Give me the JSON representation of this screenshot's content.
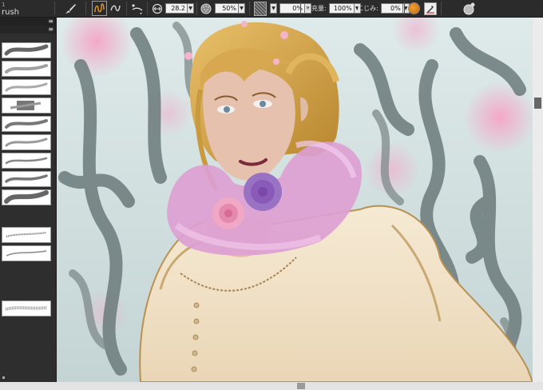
{
  "panel": {
    "title": "rush",
    "number": "1"
  },
  "toolbar": {
    "brush_size": "28.2",
    "density": "50%",
    "texture_strength": "0%",
    "refill_label": "補充量:",
    "refill_value": "100%",
    "blur_label": "にじみ:",
    "blur_value": "0%"
  },
  "icons": {
    "brush_tool": "brush-icon",
    "stroke_mode": "stroke-mode-icon",
    "size": "brush-size-icon",
    "density": "density-icon",
    "texture": "texture-icon",
    "color": "color-swatch",
    "eyedropper": "eyedropper-icon"
  },
  "colors": {
    "accent_orange": "#e2932a",
    "toolbar_bg": "#2b2b2b",
    "panel_bg": "#2e2e2e"
  }
}
